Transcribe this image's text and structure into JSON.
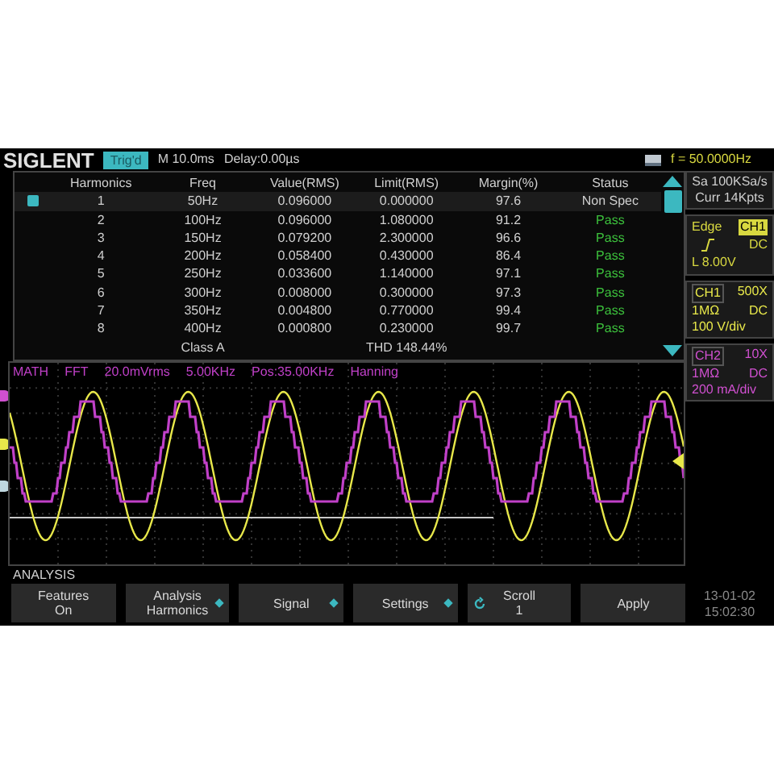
{
  "top_bar": {
    "brand": "SIGLENT",
    "trigger_state": "Trig'd",
    "timebase": "M 10.0ms",
    "delay": "Delay:0.00µs",
    "frequency": "f = 50.0000Hz"
  },
  "table": {
    "columns": [
      "Harmonics",
      "Freq",
      "Value(RMS)",
      "Limit(RMS)",
      "Margin(%)",
      "Status"
    ],
    "rows": [
      {
        "cells": [
          "1",
          "50Hz",
          "0.096000",
          "0.000000",
          "97.6",
          "Non Spec"
        ],
        "passed": false,
        "selected": true
      },
      {
        "cells": [
          "2",
          "100Hz",
          "0.096000",
          "1.080000",
          "91.2",
          "Pass"
        ],
        "passed": true,
        "selected": false
      },
      {
        "cells": [
          "3",
          "150Hz",
          "0.079200",
          "2.300000",
          "96.6",
          "Pass"
        ],
        "passed": true,
        "selected": false
      },
      {
        "cells": [
          "4",
          "200Hz",
          "0.058400",
          "0.430000",
          "86.4",
          "Pass"
        ],
        "passed": true,
        "selected": false
      },
      {
        "cells": [
          "5",
          "250Hz",
          "0.033600",
          "1.140000",
          "97.1",
          "Pass"
        ],
        "passed": true,
        "selected": false
      },
      {
        "cells": [
          "6",
          "300Hz",
          "0.008000",
          "0.300000",
          "97.3",
          "Pass"
        ],
        "passed": true,
        "selected": false
      },
      {
        "cells": [
          "7",
          "350Hz",
          "0.004800",
          "0.770000",
          "99.4",
          "Pass"
        ],
        "passed": true,
        "selected": false
      },
      {
        "cells": [
          "8",
          "400Hz",
          "0.000800",
          "0.230000",
          "99.7",
          "Pass"
        ],
        "passed": true,
        "selected": false
      }
    ],
    "class": "Class A",
    "thd": "THD 148.44%"
  },
  "side_panel": {
    "sample_rate": "Sa 100KSa/s",
    "memory": "Curr 14Kpts",
    "trigger": {
      "type": "Edge",
      "source": "CH1",
      "coupling": "DC",
      "level": "L 8.00V"
    },
    "channels": [
      {
        "name": "CH1",
        "probe": "500X",
        "impedance": "1MΩ",
        "coupling": "DC",
        "scale": "100 V/div",
        "color": "#e8e84a"
      },
      {
        "name": "CH2",
        "probe": "10X",
        "impedance": "1MΩ",
        "coupling": "DC",
        "scale": "200 mA/div",
        "color": "#d050d0"
      }
    ]
  },
  "math_bar": [
    "MATH",
    "FFT",
    "20.0mVrms",
    "5.00KHz",
    "Pos:35.00KHz",
    "Hanning"
  ],
  "menu": {
    "title": "ANALYSIS",
    "buttons": [
      {
        "lines": [
          "Features",
          "On"
        ],
        "kind": "plain"
      },
      {
        "lines": [
          "Analysis",
          "Harmonics"
        ],
        "kind": "submenu"
      },
      {
        "lines": [
          "Signal"
        ],
        "kind": "submenu"
      },
      {
        "lines": [
          "Settings"
        ],
        "kind": "submenu"
      },
      {
        "lines": [
          "Scroll",
          "1"
        ],
        "kind": "knob"
      },
      {
        "lines": [
          "Apply"
        ],
        "kind": "plain"
      }
    ]
  },
  "clock": {
    "date": "13-01-02",
    "time": "15:02:30"
  }
}
